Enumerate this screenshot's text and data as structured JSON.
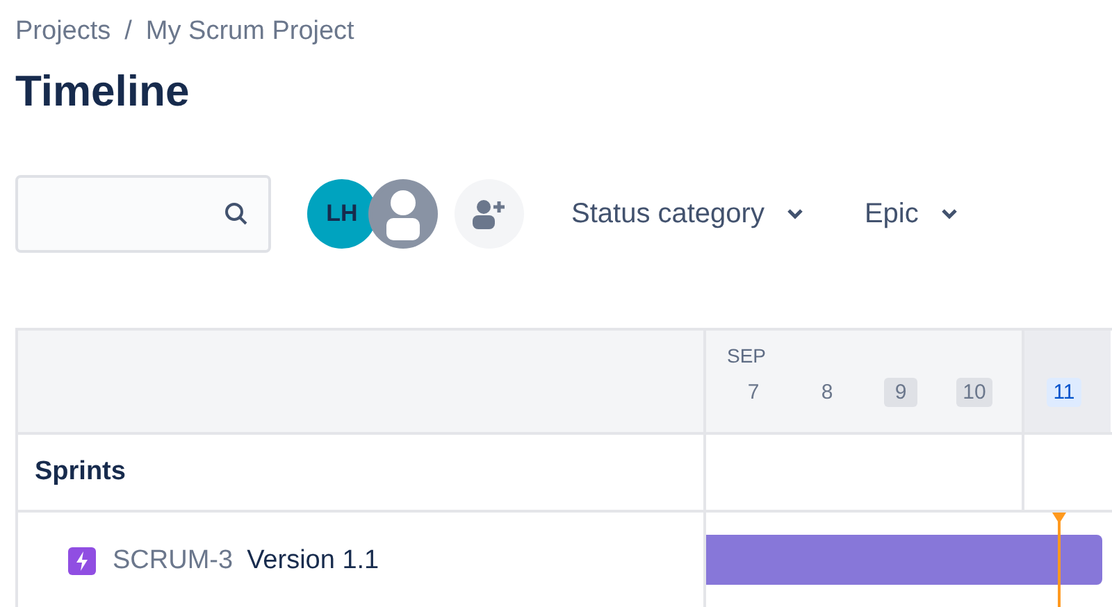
{
  "breadcrumbs": [
    "Projects",
    "My Scrum Project"
  ],
  "breadcrumb_separator": "/",
  "title": "Timeline",
  "avatars": [
    {
      "kind": "initials",
      "text": "LH"
    },
    {
      "kind": "silhouette"
    }
  ],
  "filters": [
    "Status category",
    "Epic"
  ],
  "timeline": {
    "month": "SEP",
    "days": [
      {
        "label": "7",
        "kind": "weekday"
      },
      {
        "label": "8",
        "kind": "weekday"
      },
      {
        "label": "9",
        "kind": "weekend"
      },
      {
        "label": "10",
        "kind": "weekend"
      },
      {
        "label": "11",
        "kind": "today"
      }
    ],
    "section": "Sprints",
    "rows": [
      {
        "key": "SCRUM-3",
        "name": "Version 1.1"
      }
    ]
  }
}
